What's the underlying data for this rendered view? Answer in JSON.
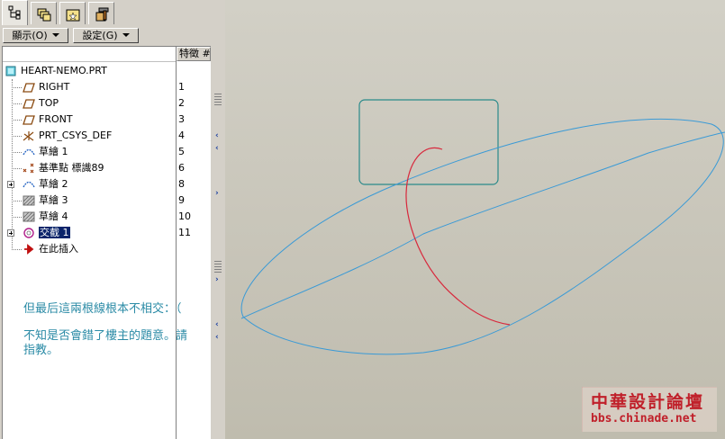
{
  "toolbar": {
    "display_menu": "顯示(O)",
    "settings_menu": "設定(G)"
  },
  "tree": {
    "column_header": "特徵 #",
    "root": "HEART-NEMO.PRT",
    "items": [
      {
        "label": "RIGHT",
        "num": "1",
        "icon": "datum-plane-icon"
      },
      {
        "label": "TOP",
        "num": "2",
        "icon": "datum-plane-icon"
      },
      {
        "label": "FRONT",
        "num": "3",
        "icon": "datum-plane-icon"
      },
      {
        "label": "PRT_CSYS_DEF",
        "num": "4",
        "icon": "coordinate-system-icon"
      },
      {
        "label": "草繪 1",
        "num": "5",
        "icon": "sketch-icon"
      },
      {
        "label": "基準點 標識89",
        "num": "6",
        "icon": "datum-point-icon"
      },
      {
        "label": "草繪 2",
        "num": "8",
        "icon": "sketch-icon"
      },
      {
        "label": "草繪 3",
        "num": "9",
        "icon": "hatched-sketch-icon"
      },
      {
        "label": "草繪 4",
        "num": "10",
        "icon": "hatched-sketch-icon"
      },
      {
        "label": "交截 1",
        "num": "11",
        "icon": "intersect-curve-icon"
      },
      {
        "label": "在此插入",
        "num": "",
        "icon": "insert-here-arrow-icon"
      }
    ]
  },
  "note": {
    "line1": "但最后這兩根線根本不相交：（",
    "line2": "不知是否會錯了樓主的題意。請指教。"
  },
  "watermark": {
    "title": "中華設計論壇",
    "url": "bbs.chinade.net"
  },
  "colors": {
    "curve_blue": "#3a9ad6",
    "curve_red": "#d8283c",
    "box_teal": "#2a8a8a",
    "note_text": "#2b8ba6"
  }
}
